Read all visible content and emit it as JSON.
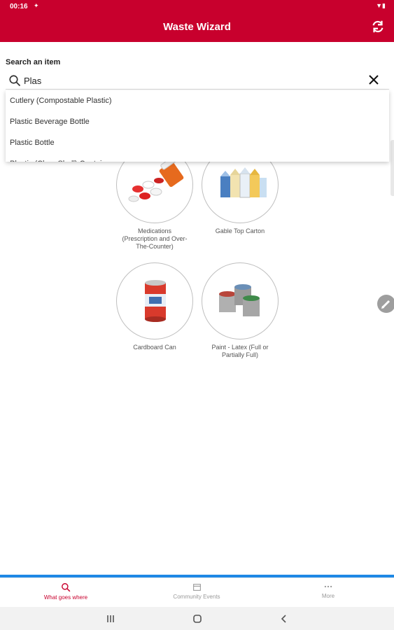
{
  "status": {
    "time": "00:16",
    "icons": "▼▮"
  },
  "header": {
    "title": "Waste Wizard",
    "refresh_icon": "refresh-icon"
  },
  "search": {
    "label": "Search an item",
    "value": "Plas",
    "placeholder": "",
    "suggestions": [
      "Cutlery (Compostable Plastic)",
      "Plastic Beverage Bottle",
      "Plastic Bottle",
      "Plastic (Clear Shell) Containers"
    ]
  },
  "items": [
    {
      "label": "Medications (Prescription and Over-The-Counter)"
    },
    {
      "label": "Gable Top Carton"
    },
    {
      "label": "Cardboard Can"
    },
    {
      "label": "Paint - Latex (Full or Partially Full)"
    }
  ],
  "bottom_nav": [
    {
      "label": "What goes where",
      "icon": "search-icon",
      "active": true
    },
    {
      "label": "Community Events",
      "icon": "calendar-icon",
      "active": false
    },
    {
      "label": "More",
      "icon": "more-icon",
      "active": false
    }
  ],
  "colors": {
    "brand": "#c8002d",
    "accent_line": "#1e88e5"
  }
}
